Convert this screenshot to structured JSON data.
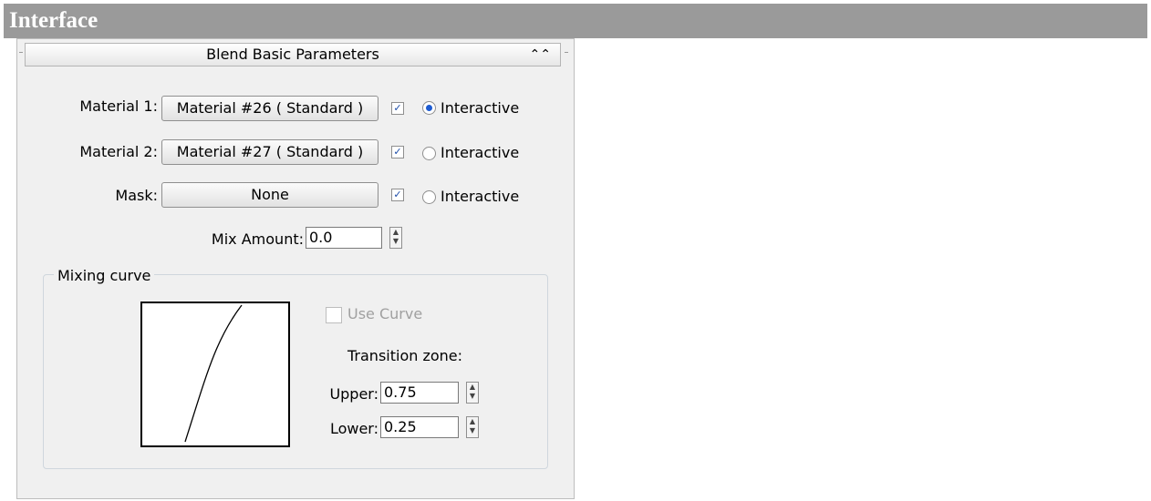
{
  "page": {
    "title": "Interface"
  },
  "rollout": {
    "title": "Blend Basic Parameters",
    "collapse_glyph": "⌃⌃"
  },
  "materials": [
    {
      "label": "Material 1:",
      "button": "Material #26  ( Standard )",
      "checked": true,
      "radio_label": "Interactive",
      "radio_selected": true
    },
    {
      "label": "Material 2:",
      "button": "Material #27  ( Standard )",
      "checked": true,
      "radio_label": "Interactive",
      "radio_selected": false
    },
    {
      "label": "Mask:",
      "button": "None",
      "checked": true,
      "radio_label": "Interactive",
      "radio_selected": false
    }
  ],
  "mix": {
    "label": "Mix Amount:",
    "value": "0.0"
  },
  "mixing_curve": {
    "group_title": "Mixing curve",
    "use_curve_label": "Use Curve",
    "use_curve_checked": false,
    "transition_label": "Transition zone:",
    "upper_label": "Upper:",
    "upper_value": "0.75",
    "lower_label": "Lower:",
    "lower_value": "0.25"
  },
  "icons": {
    "spinner": "spinner-arrows-icon",
    "collapse": "double-chevron-up-icon",
    "check": "checkmark-icon"
  }
}
